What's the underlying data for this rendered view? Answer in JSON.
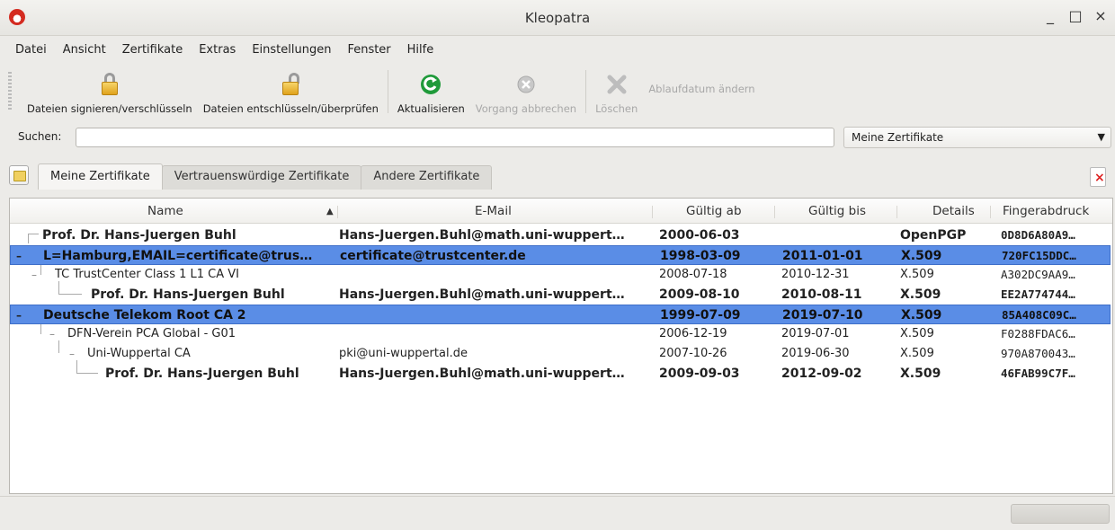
{
  "window": {
    "title": "Kleopatra",
    "minimize": "_",
    "maximize": "□",
    "close": "×"
  },
  "menu": [
    "Datei",
    "Ansicht",
    "Zertifikate",
    "Extras",
    "Einstellungen",
    "Fenster",
    "Hilfe"
  ],
  "toolbar": {
    "sign_encrypt": "Dateien signieren/verschlüsseln",
    "decrypt_verify": "Dateien entschlüsseln/überprüfen",
    "refresh": "Aktualisieren",
    "cancel": "Vorgang abbrechen",
    "delete": "Löschen",
    "change_expiry": "Ablaufdatum ändern"
  },
  "search": {
    "label": "Suchen:",
    "value": "",
    "filter": "Meine Zertifikate"
  },
  "tabs": [
    "Meine Zertifikate",
    "Vertrauenswürdige Zertifikate",
    "Andere Zertifikate"
  ],
  "table": {
    "headers": [
      "Name",
      "E-Mail",
      "Gültig ab",
      "Gültig bis",
      "Details",
      "Fingerabdruck"
    ],
    "rows": [
      {
        "name": "Prof. Dr. Hans-Juergen Buhl",
        "email": "Hans-Juergen.Buhl@math.uni-wuppert…",
        "from": "2000-06-03",
        "to": "",
        "details": "OpenPGP",
        "fp": "0D8D6A80A9…"
      },
      {
        "name": "L=Hamburg,EMAIL=certificate@trus…",
        "email": "certificate@trustcenter.de",
        "from": "1998-03-09",
        "to": "2011-01-01",
        "details": "X.509",
        "fp": "720FC15DDC…"
      },
      {
        "name": "TC TrustCenter Class 1 L1 CA VI",
        "email": "",
        "from": "2008-07-18",
        "to": "2010-12-31",
        "details": "X.509",
        "fp": "A302DC9AA9…"
      },
      {
        "name": "Prof. Dr. Hans-Juergen Buhl",
        "email": "Hans-Juergen.Buhl@math.uni-wuppert…",
        "from": "2009-08-10",
        "to": "2010-08-11",
        "details": "X.509",
        "fp": "EE2A774744…"
      },
      {
        "name": "Deutsche Telekom Root CA 2",
        "email": "",
        "from": "1999-07-09",
        "to": "2019-07-10",
        "details": "X.509",
        "fp": "85A408C09C…"
      },
      {
        "name": "DFN-Verein PCA Global - G01",
        "email": "",
        "from": "2006-12-19",
        "to": "2019-07-01",
        "details": "X.509",
        "fp": "F0288FDAC6…"
      },
      {
        "name": "Uni-Wuppertal CA",
        "email": "pki@uni-wuppertal.de",
        "from": "2007-10-26",
        "to": "2019-06-30",
        "details": "X.509",
        "fp": "970A870043…"
      },
      {
        "name": "Prof. Dr. Hans-Juergen Buhl",
        "email": "Hans-Juergen.Buhl@math.uni-wuppert…",
        "from": "2009-09-03",
        "to": "2012-09-02",
        "details": "X.509",
        "fp": "46FAB99C7F…"
      }
    ]
  }
}
